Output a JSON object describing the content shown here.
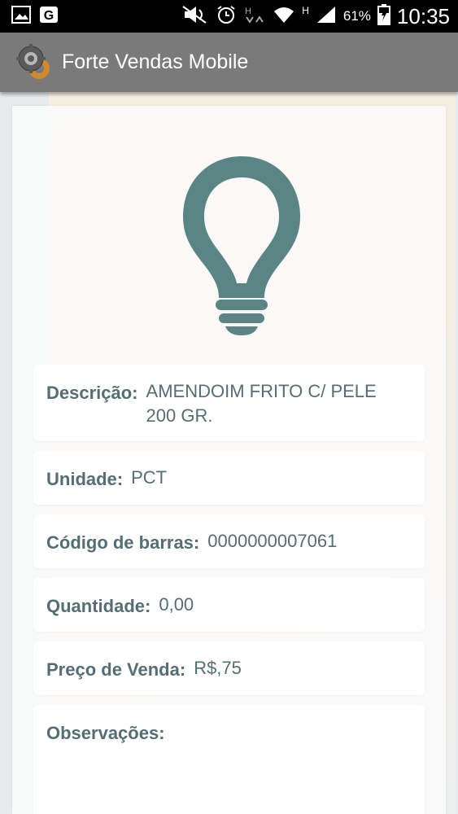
{
  "status_bar": {
    "battery_percent": "61%",
    "time": "10:35",
    "network_label": "H"
  },
  "action_bar": {
    "title": "Forte Vendas Mobile"
  },
  "product": {
    "descricao_label": "Descrição:",
    "descricao_value_line1": "AMENDOIM FRITO C/ PELE",
    "descricao_value_line2": "200 GR.",
    "unidade_label": "Unidade:",
    "unidade_value": "PCT",
    "codigo_label": "Código de barras:",
    "codigo_value": "0000000007061",
    "quantidade_label": "Quantidade:",
    "quantidade_value": "0,00",
    "preco_label": "Preço de Venda:",
    "preco_value": "R$,75",
    "observacoes_label": "Observações:"
  },
  "colors": {
    "accent": "#5b8585",
    "text": "#546e74",
    "action_bar": "#7a7a7a"
  }
}
